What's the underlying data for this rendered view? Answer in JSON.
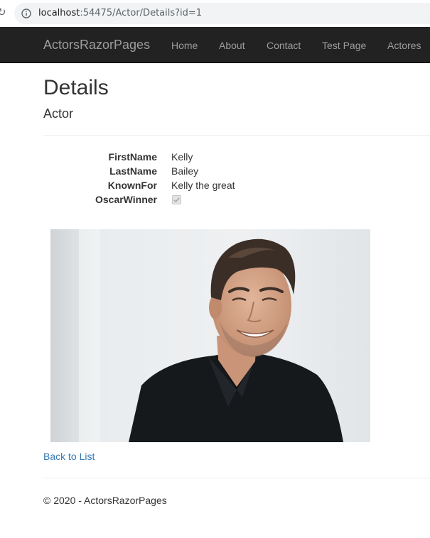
{
  "browser": {
    "url_host": "localhost",
    "url_path": ":54475/Actor/Details?id=1"
  },
  "navbar": {
    "brand": "ActorsRazorPages",
    "links": [
      "Home",
      "About",
      "Contact",
      "Test Page",
      "Actores"
    ]
  },
  "page": {
    "title": "Details",
    "subtitle": "Actor"
  },
  "details": [
    {
      "label": "FirstName",
      "value": "Kelly"
    },
    {
      "label": "LastName",
      "value": "Bailey"
    },
    {
      "label": "KnownFor",
      "value": "Kelly the great"
    },
    {
      "label": "OscarWinner",
      "checked": true
    }
  ],
  "back_link": "Back to List",
  "footer": "© 2020 - ActorsRazorPages",
  "colors": {
    "navbar_bg": "#222222",
    "nav_text": "#9d9d9d",
    "link": "#337ab7",
    "text": "#333333"
  }
}
